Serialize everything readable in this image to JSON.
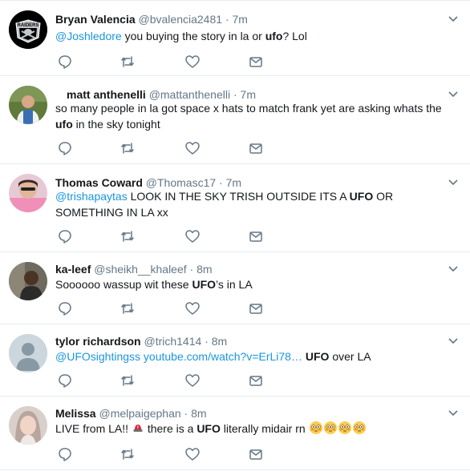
{
  "colors": {
    "link": "#1b95e0",
    "muted": "#657786",
    "divider": "#e6ecf0"
  },
  "tweets": [
    {
      "name": "Bryan Valencia",
      "handle": "@bvalencia2481",
      "sep": "·",
      "time": "7m",
      "avatar_icon": "raiders-logo-avatar",
      "avatar_text": "RAIDERS",
      "text": {
        "mention": "@Joshledore",
        "p1": " you buying the story in la or ",
        "b1": "ufo",
        "p2": "? Lol"
      }
    },
    {
      "name": "matt anthenelli",
      "handle": "@mattanthenelli",
      "sep": "·",
      "time": "7m",
      "avatar_icon": "person-photo-avatar",
      "text": {
        "p1": "so many people in la got space x hats to match frank yet are asking whats the ",
        "b1": "ufo",
        "p2": " in the sky tonight"
      }
    },
    {
      "name": "Thomas Coward",
      "handle": "@Thomasc17",
      "sep": "·",
      "time": "7m",
      "avatar_icon": "person-photo-avatar",
      "text": {
        "mention": "@trishapaytas",
        "p1": " LOOK IN THE SKY TRISH OUTSIDE ITS A ",
        "b1": "UFO",
        "p2": " OR SOMETHING IN LA xx"
      }
    },
    {
      "name": "ka-leef",
      "handle": "@sheikh__khaleef",
      "sep": "·",
      "time": "8m",
      "avatar_icon": "person-photo-avatar",
      "text": {
        "p1": "Soooooo wassup wit these ",
        "b1": "UFO",
        "p2": "’s in LA"
      }
    },
    {
      "name": "tylor richardson",
      "handle": "@trich1414",
      "sep": "·",
      "time": "8m",
      "avatar_icon": "default-profile-avatar",
      "text": {
        "mention": "@UFOsightingss",
        "link": " youtube.com/watch?v=ErLi78…",
        "p1": " ",
        "b1": "UFO",
        "p2": " over LA"
      }
    },
    {
      "name": "Melissa",
      "handle": "@melpaigephan",
      "sep": "·",
      "time": "8m",
      "avatar_icon": "person-photo-avatar",
      "text": {
        "p1": "LIVE from LA!! ",
        "emoji1": "police-light-emoji",
        "p2": " there is a ",
        "b1": "UFO",
        "p3": " literally midair rn ",
        "emojis": [
          "flushed-face-emoji",
          "flushed-face-emoji",
          "flushed-face-emoji",
          "flushed-face-emoji"
        ]
      }
    }
  ]
}
